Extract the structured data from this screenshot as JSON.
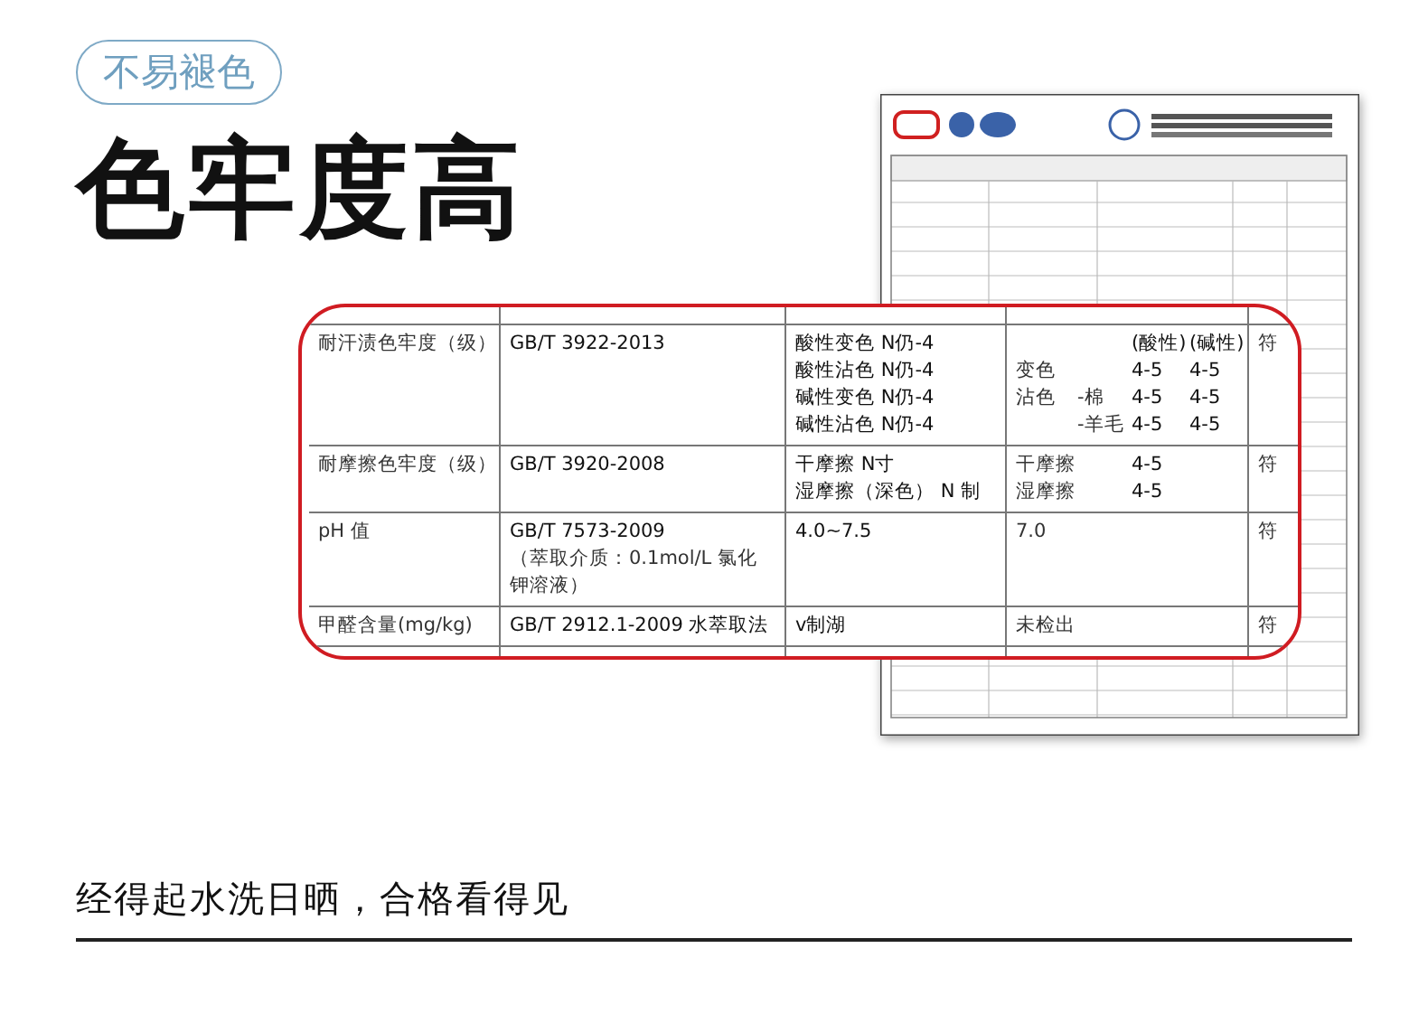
{
  "tag": "不易褪色",
  "title": "色牢度高",
  "table": {
    "rows": [
      {
        "item": "耐汗渍色牢度（级）",
        "method": [
          "GB/T 3922-2013"
        ],
        "requirement": [
          "酸性变色 N仍-4",
          "酸性沾色 N仍-4",
          "碱性变色 N仍-4",
          "碱性沾色 N仍-4"
        ],
        "result": [
          {
            "acid": "(酸性)",
            "alkali": "(碱性)"
          },
          {
            "label": "变色",
            "acid": "4-5",
            "alkali": "4-5"
          },
          {
            "label": "沾色",
            "sub": "-棉",
            "acid": "4-5",
            "alkali": "4-5"
          },
          {
            "sub": "-羊毛",
            "acid": "4-5",
            "alkali": "4-5"
          }
        ],
        "verdict": "符"
      },
      {
        "item": "耐摩擦色牢度（级）",
        "method": [
          "GB/T 3920-2008"
        ],
        "requirement": [
          "干摩擦 N寸",
          "湿摩擦（深色） N 制"
        ],
        "result": [
          {
            "label": "干摩擦",
            "acid": "4-5"
          },
          {
            "label": "湿摩擦",
            "acid": "4-5"
          }
        ],
        "verdict": "符"
      },
      {
        "item": "pH 值",
        "method": [
          "GB/T 7573-2009",
          "（萃取介质：0.1mol/L 氯化钾溶液）"
        ],
        "requirement": [
          "4.0~7.5"
        ],
        "result": [
          {
            "label": "7.0"
          }
        ],
        "verdict": "符"
      },
      {
        "item": "甲醛含量(mg/kg)",
        "method": [
          "GB/T 2912.1-2009 水萃取法"
        ],
        "requirement": [
          "v制湖"
        ],
        "result": [
          {
            "label": "未检出"
          }
        ],
        "verdict": "符"
      }
    ]
  },
  "slogan": "经得起水洗日晒，合格看得见"
}
